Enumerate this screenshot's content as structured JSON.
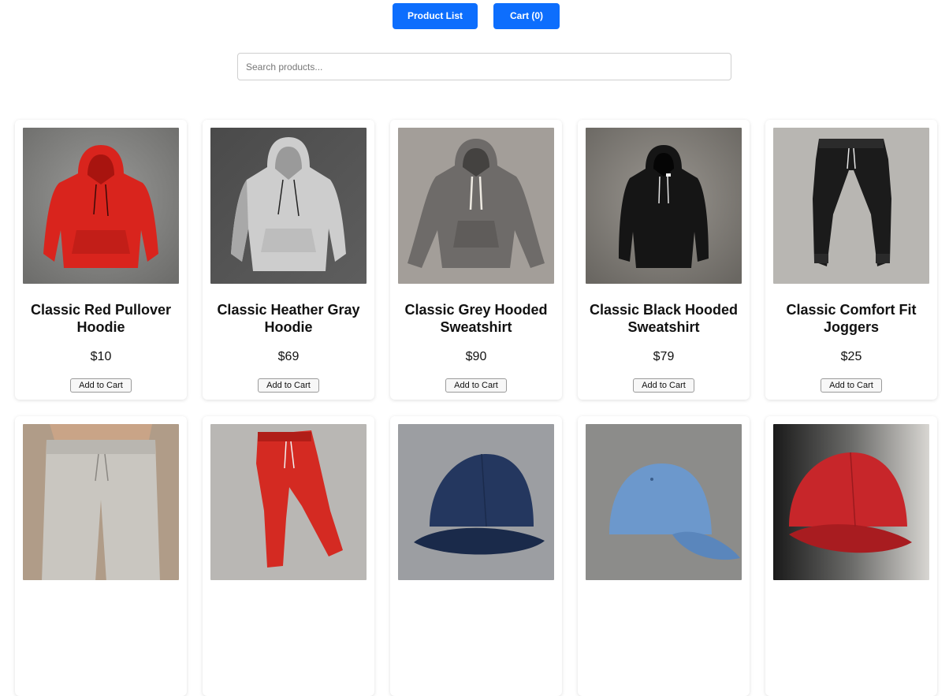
{
  "nav": {
    "product_list_label": "Product List",
    "cart_label": "Cart (0)"
  },
  "search": {
    "placeholder": "Search products...",
    "value": ""
  },
  "products": [
    {
      "name": "Classic Red Pullover Hoodie",
      "price": "$10",
      "button": "Add to Cart",
      "image": "red-hoodie-image",
      "color": "#d9241d"
    },
    {
      "name": "Classic Heather Gray Hoodie",
      "price": "$69",
      "button": "Add to Cart",
      "image": "gray-hoodie-image",
      "color": "#c9c9c9"
    },
    {
      "name": "Classic Grey Hooded Sweatshirt",
      "price": "$90",
      "button": "Add to Cart",
      "image": "grey-sweatshirt-image",
      "color": "#6e6b69"
    },
    {
      "name": "Classic Black Hooded Sweatshirt",
      "price": "$79",
      "button": "Add to Cart",
      "image": "black-sweatshirt-image",
      "color": "#151515"
    },
    {
      "name": "Classic Comfort Fit Joggers",
      "price": "$25",
      "button": "Add to Cart",
      "image": "black-joggers-image",
      "color": "#1b1b1b"
    },
    {
      "name": "",
      "price": "",
      "button": "",
      "image": "gray-sweatpants-image",
      "color": "#c9c6c0"
    },
    {
      "name": "",
      "price": "",
      "button": "",
      "image": "red-joggers-image",
      "color": "#d42a22"
    },
    {
      "name": "",
      "price": "",
      "button": "",
      "image": "navy-cap-image",
      "color": "#24375f"
    },
    {
      "name": "",
      "price": "",
      "button": "",
      "image": "light-blue-cap-image",
      "color": "#6c98cc"
    },
    {
      "name": "",
      "price": "",
      "button": "",
      "image": "red-cap-image",
      "color": "#c7262a"
    }
  ],
  "colors": {
    "accent": "#0d6efd"
  }
}
